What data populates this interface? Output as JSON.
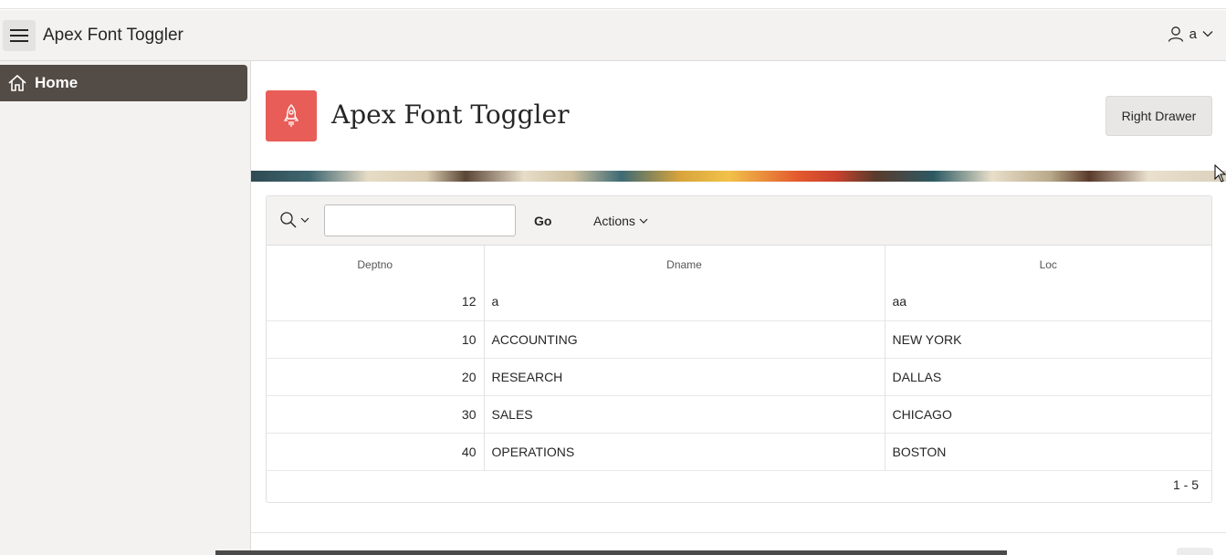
{
  "header": {
    "app_title": "Apex Font Toggler",
    "user_name": "a"
  },
  "sidebar": {
    "items": [
      {
        "label": "Home",
        "icon": "home-icon"
      }
    ]
  },
  "hero": {
    "title": "Apex Font Toggler",
    "icon": "rocket-icon",
    "icon_color": "#e85d57",
    "drawer_button": "Right Drawer"
  },
  "report": {
    "search_value": "",
    "go_label": "Go",
    "actions_label": "Actions",
    "columns": [
      "Deptno",
      "Dname",
      "Loc"
    ],
    "rows": [
      [
        "12",
        "a",
        "aa"
      ],
      [
        "10",
        "ACCOUNTING",
        "NEW YORK"
      ],
      [
        "20",
        "RESEARCH",
        "DALLAS"
      ],
      [
        "30",
        "SALES",
        "CHICAGO"
      ],
      [
        "40",
        "OPERATIONS",
        "BOSTON"
      ]
    ],
    "pagination": "1 - 5"
  },
  "colors": {
    "nav_active": "#534b45",
    "header_bg": "#f3f2f1"
  }
}
